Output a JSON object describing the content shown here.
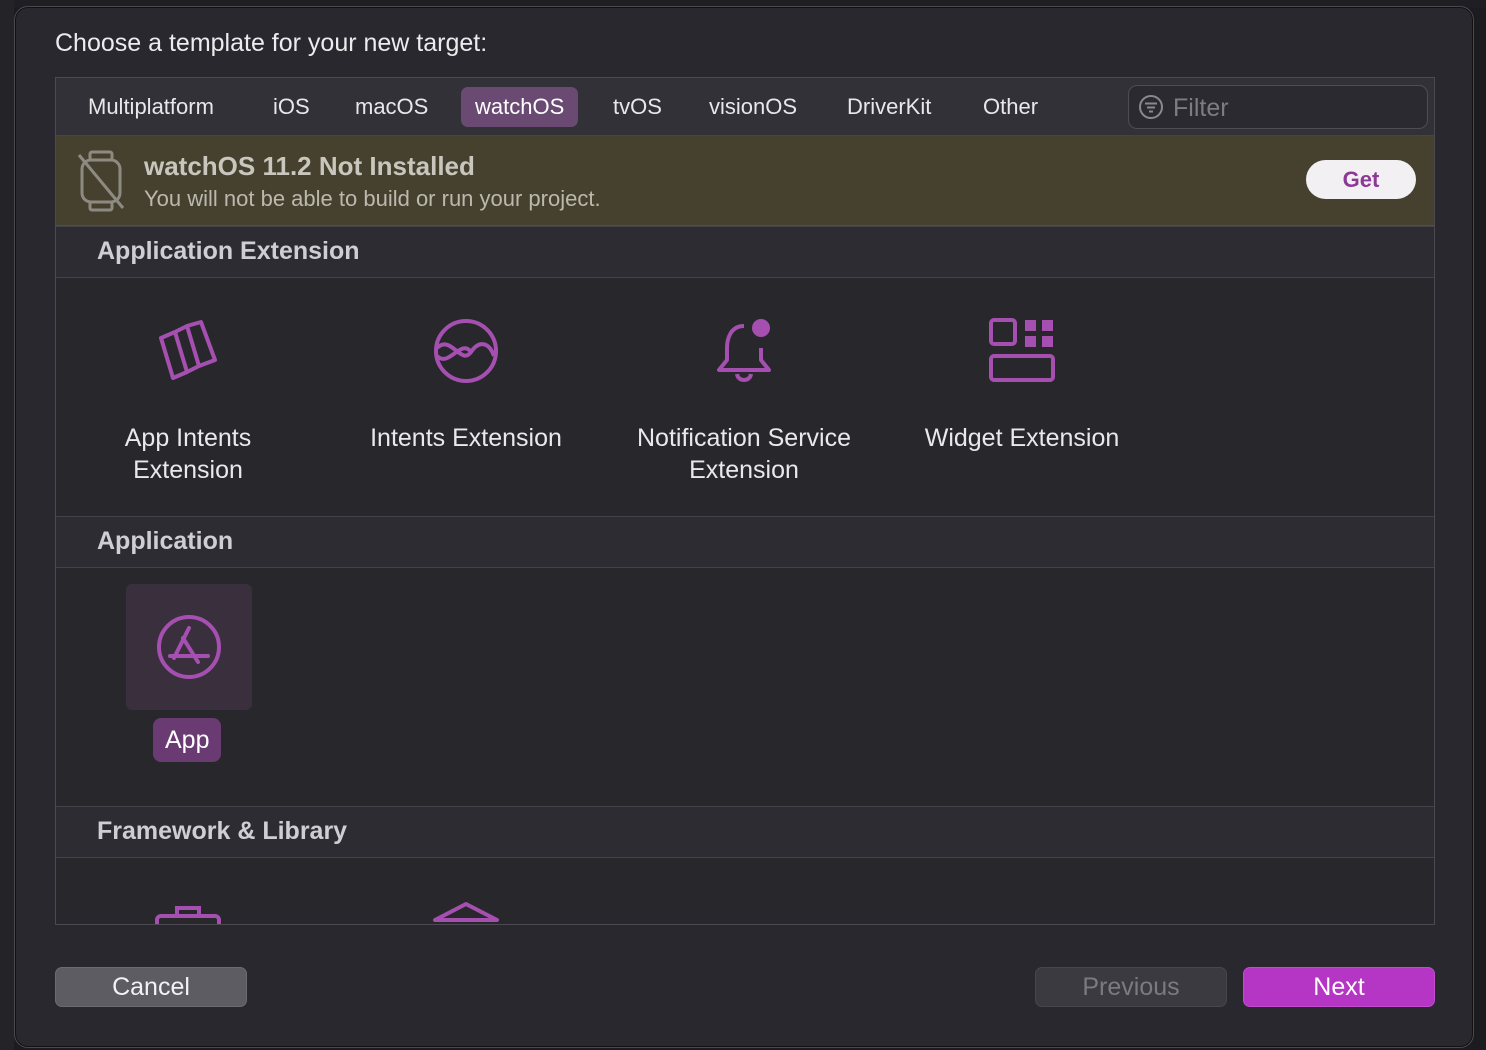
{
  "dialog": {
    "title": "Choose a template for your new target:"
  },
  "tabs": [
    {
      "label": "Multiplatform"
    },
    {
      "label": "iOS"
    },
    {
      "label": "macOS"
    },
    {
      "label": "watchOS",
      "selected": true
    },
    {
      "label": "tvOS"
    },
    {
      "label": "visionOS"
    },
    {
      "label": "DriverKit"
    },
    {
      "label": "Other"
    }
  ],
  "filter": {
    "placeholder": "Filter",
    "value": ""
  },
  "banner": {
    "title": "watchOS 11.2 Not Installed",
    "subtitle": "You will not be able to build or run your project.",
    "get_label": "Get"
  },
  "sections": [
    {
      "title": "Application Extension",
      "items": [
        {
          "label": "App Intents Extension",
          "icon": "app-intents-icon"
        },
        {
          "label": "Intents Extension",
          "icon": "intents-icon"
        },
        {
          "label": "Notification Service Extension",
          "icon": "bell-icon"
        },
        {
          "label": "Widget Extension",
          "icon": "widget-icon"
        }
      ]
    },
    {
      "title": "Application",
      "items": [
        {
          "label": "App",
          "icon": "app-store-icon",
          "selected": true
        }
      ]
    },
    {
      "title": "Framework & Library",
      "items": [
        {
          "label": "",
          "icon": "toolbox-icon"
        },
        {
          "label": "",
          "icon": "library-icon"
        }
      ]
    }
  ],
  "footer": {
    "cancel_label": "Cancel",
    "previous_label": "Previous",
    "next_label": "Next"
  },
  "colors": {
    "accent": "#b535c4",
    "icon": "#a550b0",
    "banner_bg": "#46412f"
  }
}
